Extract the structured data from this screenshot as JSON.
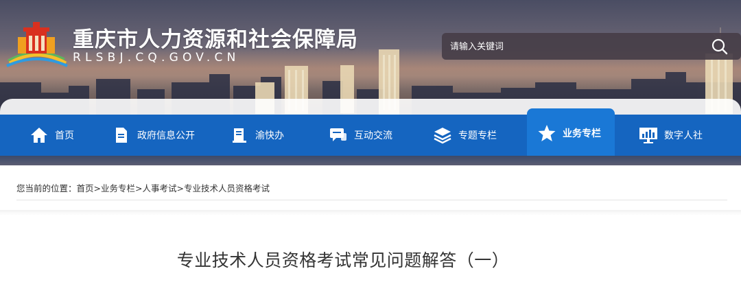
{
  "header": {
    "site_title": "重庆市人力资源和社会保障局",
    "site_domain": "RLSBJ.CQ.GOV.CN",
    "logo_icon": "government-building-logo"
  },
  "search": {
    "placeholder": "请输入关键词",
    "icon": "search-icon"
  },
  "nav": {
    "items": [
      {
        "label": "首页",
        "icon": "home-icon"
      },
      {
        "label": "政府信息公开",
        "icon": "document-icon"
      },
      {
        "label": "渝快办",
        "icon": "clipboard-icon"
      },
      {
        "label": "互动交流",
        "icon": "chat-icon"
      },
      {
        "label": "专题专栏",
        "icon": "layers-icon"
      },
      {
        "label": "业务专栏",
        "icon": "star-icon",
        "active": true
      },
      {
        "label": "数字人社",
        "icon": "monitor-chart-icon"
      }
    ]
  },
  "breadcrumb": {
    "prefix": "您当前的位置：",
    "items": [
      "首页",
      "业务专栏",
      "人事考试",
      "专业技术人员资格考试"
    ],
    "separator": ">"
  },
  "article": {
    "title": "专业技术人员资格考试常见问题解答（一）"
  },
  "colors": {
    "nav_blue": "#1565c0",
    "nav_active": "#1a78d6",
    "text": "#333333"
  }
}
